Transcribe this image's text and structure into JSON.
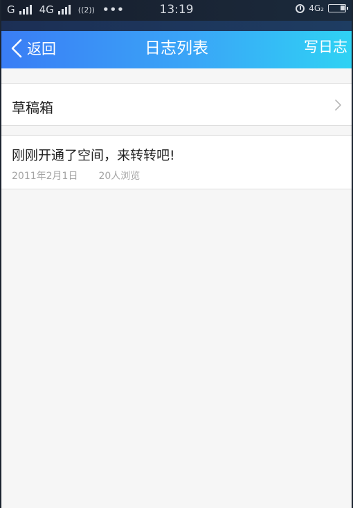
{
  "status_bar": {
    "net1": "G",
    "net2": "4G",
    "hd": "((2))",
    "dots": "•••",
    "time": "13:19",
    "net3": "4G₂"
  },
  "header": {
    "back_label": "返回",
    "title": "日志列表",
    "write_label": "写日志"
  },
  "drafts": {
    "label": "草稿箱"
  },
  "posts": [
    {
      "title": "刚刚开通了空间，来转转吧!",
      "date": "2011年2月1日",
      "views": "20人浏览"
    }
  ],
  "colors": {
    "accent_start": "#3a7df5",
    "accent_end": "#2fd2f4",
    "background": "#f6f6f6"
  }
}
